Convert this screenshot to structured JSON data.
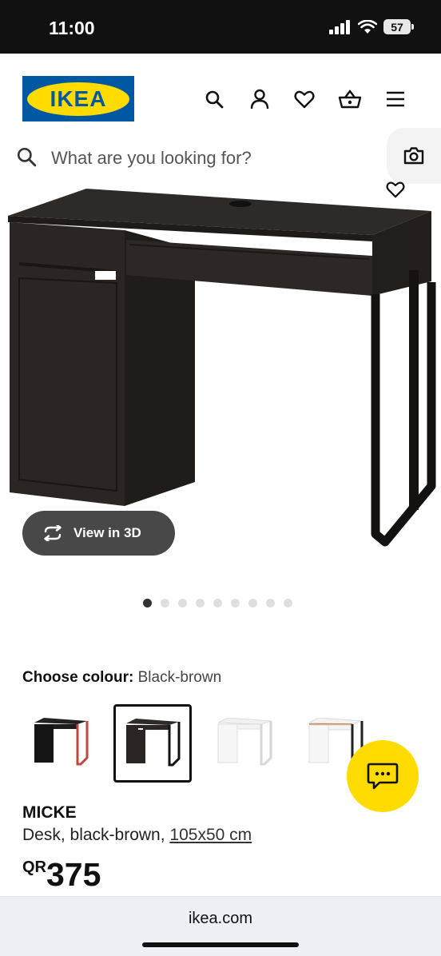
{
  "status_bar": {
    "time": "11:00",
    "battery": "57"
  },
  "header": {
    "logo_text": "IKEA",
    "icons": [
      "search-icon",
      "profile-icon",
      "heart-icon",
      "basket-icon",
      "menu-icon"
    ]
  },
  "search": {
    "placeholder": "What are you looking for?"
  },
  "product_image": {
    "view_3d_label": "View in 3D",
    "dots_total": 9,
    "dots_active_index": 0
  },
  "colour": {
    "label": "Choose colour:",
    "value": "Black-brown",
    "swatches": [
      "black-red",
      "black-brown",
      "white",
      "white-oak"
    ],
    "selected_index": 1
  },
  "product": {
    "name": "MICKE",
    "description": "Desk, black-brown,",
    "size": "105x50 cm",
    "price_currency": "QR",
    "price": "375"
  },
  "browser": {
    "url": "ikea.com"
  },
  "colors": {
    "ikea_blue": "#0058a3",
    "ikea_yellow": "#ffdb00",
    "desk_dark": "#2b2624"
  }
}
